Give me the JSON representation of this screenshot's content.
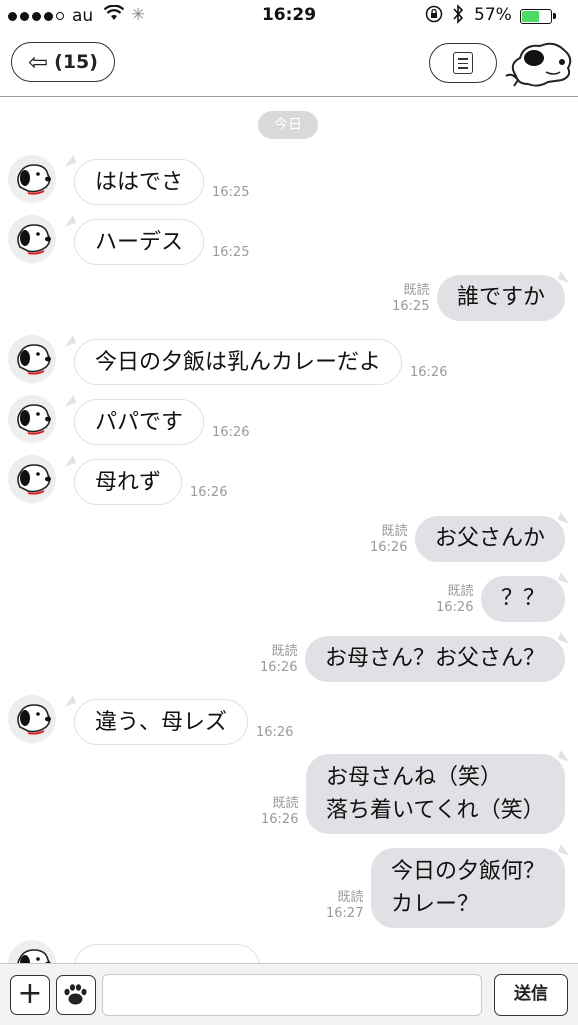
{
  "status_bar": {
    "carrier": "au",
    "time": "16:29",
    "battery_percent": "57%",
    "battery_level": 0.57,
    "signal_bars": 4
  },
  "nav": {
    "back_label": "(15)",
    "avatar_icon": "snoopy-avatar-icon",
    "menu_icon": "list-icon"
  },
  "date_label": "今日",
  "read_label": "既読",
  "messages": [
    {
      "dir": "in",
      "text": "ははでさ",
      "time": "16:25"
    },
    {
      "dir": "in",
      "text": "ハーデス",
      "time": "16:25"
    },
    {
      "dir": "out",
      "text": "誰ですか",
      "time": "16:25",
      "read": true
    },
    {
      "dir": "in",
      "text": "今日の夕飯は乳んカレーだよ",
      "time": "16:26"
    },
    {
      "dir": "in",
      "text": "パパです",
      "time": "16:26"
    },
    {
      "dir": "in",
      "text": "母れず",
      "time": "16:26"
    },
    {
      "dir": "out",
      "text": "お父さんか",
      "time": "16:26",
      "read": true
    },
    {
      "dir": "out",
      "text": "？？",
      "time": "16:26",
      "read": true
    },
    {
      "dir": "out",
      "text": "お母さん？お父さん？",
      "time": "16:26",
      "read": true
    },
    {
      "dir": "in",
      "text": "違う、母レズ",
      "time": "16:26"
    },
    {
      "dir": "out",
      "lines": [
        "お母さんね（笑）",
        "落ち着いてくれ（笑）"
      ],
      "time": "16:26",
      "read": true
    },
    {
      "dir": "out",
      "lines": [
        "今日の夕飯何？",
        "カレー？"
      ],
      "time": "16:27",
      "read": true
    }
  ],
  "composer": {
    "send_label": "送信",
    "plus_icon": "plus-icon",
    "sticker_icon": "paw-icon"
  },
  "colors": {
    "battery": "#4cd964",
    "outgoing_bubble": "#e1e1e5",
    "incoming_bubble": "#ffffff",
    "meta_text": "#9a9a9a"
  }
}
